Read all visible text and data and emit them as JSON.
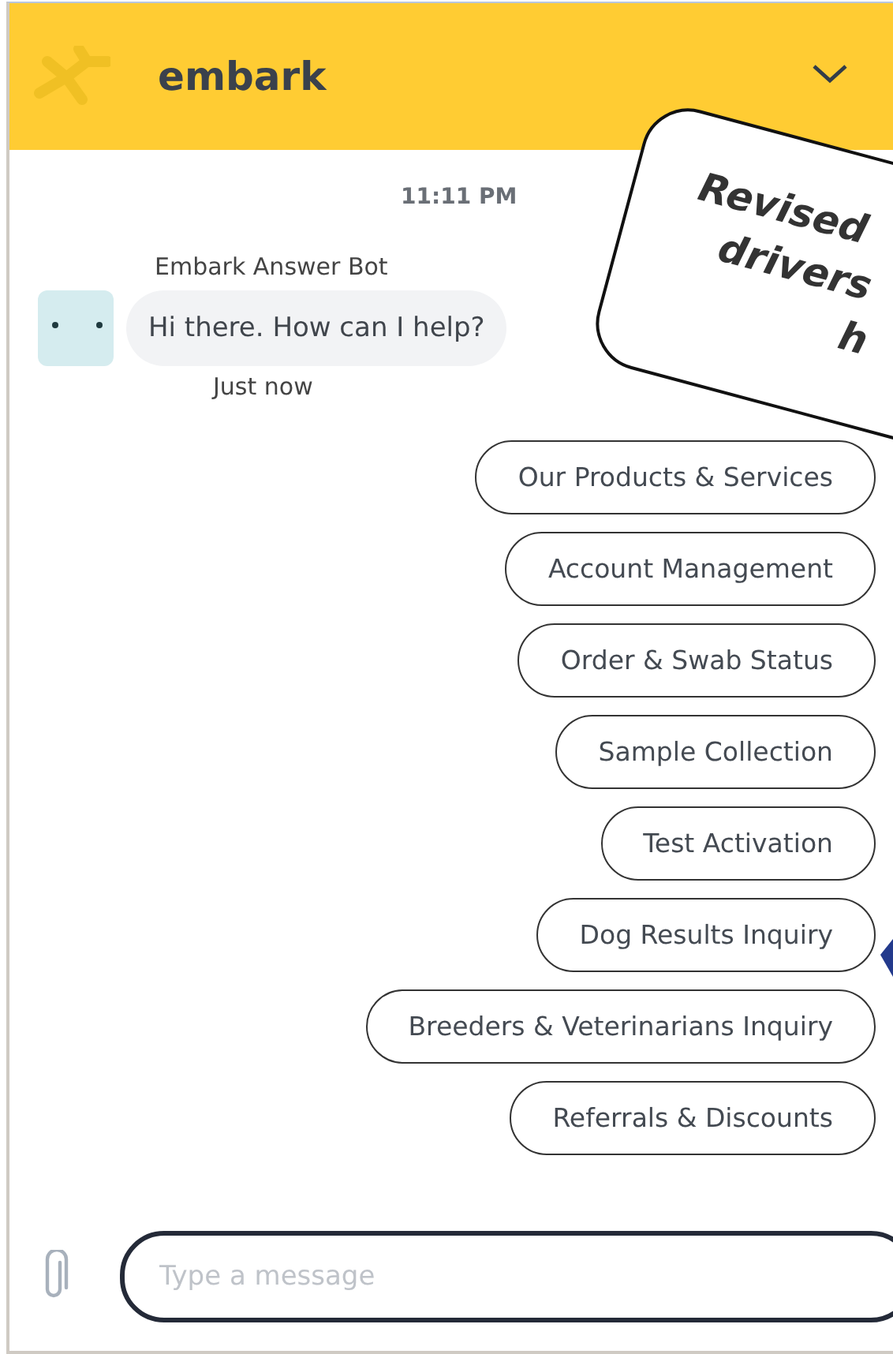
{
  "header": {
    "title": "embark"
  },
  "conversation": {
    "timestamp": "11:11 PM",
    "sender": "Embark Answer Bot",
    "message": "Hi there. How can I help?",
    "message_time": "Just now"
  },
  "quick_replies": [
    {
      "label": "Our Products & Services"
    },
    {
      "label": "Account Management"
    },
    {
      "label": "Order & Swab Status"
    },
    {
      "label": "Sample Collection"
    },
    {
      "label": "Test Activation"
    },
    {
      "label": "Dog Results Inquiry"
    },
    {
      "label": "Breeders & Veterinarians Inquiry"
    },
    {
      "label": "Referrals & Discounts"
    }
  ],
  "composer": {
    "placeholder": "Type a message"
  },
  "callout": {
    "lines": [
      "Revised",
      "drivers",
      "h"
    ]
  }
}
